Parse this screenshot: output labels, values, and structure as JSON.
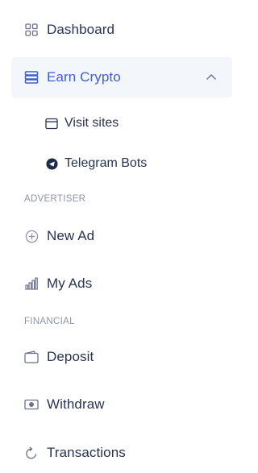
{
  "nav": {
    "dashboard": {
      "label": "Dashboard",
      "icon": "grid-icon"
    },
    "earn_crypto": {
      "label": "Earn Crypto",
      "icon": "server-icon",
      "expanded": true
    },
    "visit_sites": {
      "label": "Visit sites",
      "icon": "browser-window-icon"
    },
    "telegram_bots": {
      "label": "Telegram Bots",
      "icon": "telegram-icon"
    },
    "new_ad": {
      "label": "New Ad",
      "icon": "plus-circle-icon"
    },
    "my_ads": {
      "label": "My Ads",
      "icon": "bar-chart-icon"
    },
    "deposit": {
      "label": "Deposit",
      "icon": "wallet-icon"
    },
    "withdraw": {
      "label": "Withdraw",
      "icon": "cash-icon"
    },
    "transactions": {
      "label": "Transactions",
      "icon": "refresh-icon"
    }
  },
  "sections": {
    "advertiser": "ADVERTISER",
    "financial": "FINANCIAL"
  },
  "colors": {
    "accent": "#3f5fc8",
    "text": "#2a3350",
    "muted": "#8c93a6",
    "active_bg": "#f3f6fb"
  }
}
